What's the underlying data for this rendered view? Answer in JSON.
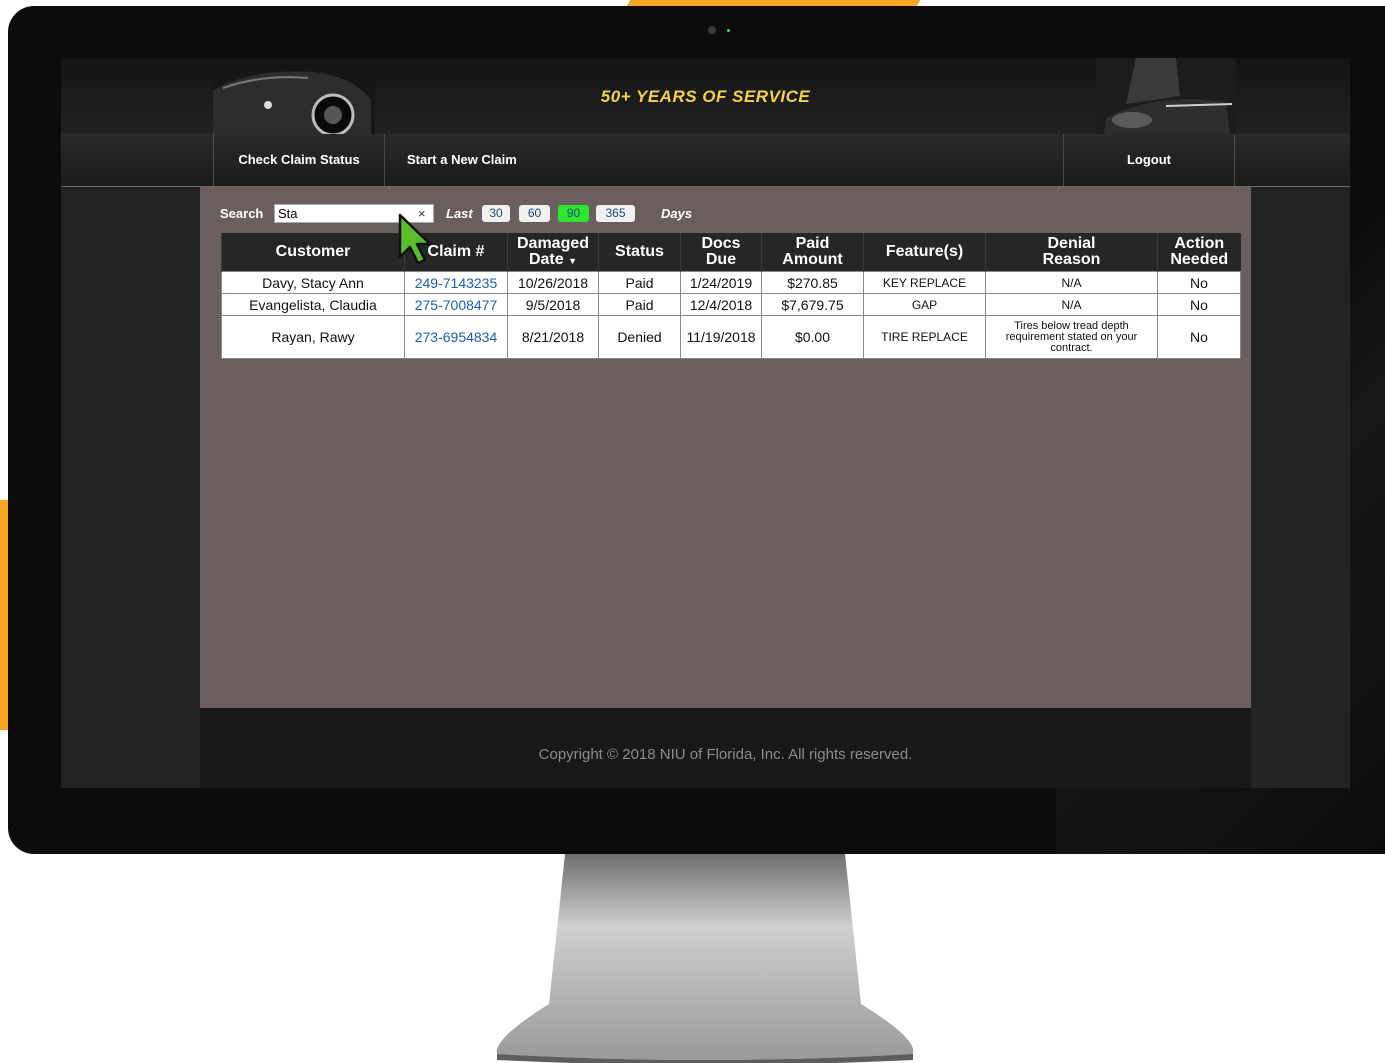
{
  "header": {
    "tagline": "50+ YEARS OF SERVICE"
  },
  "nav": {
    "check_status": "Check Claim Status",
    "new_claim": "Start a New Claim",
    "logout": "Logout"
  },
  "search": {
    "label": "Search",
    "value": "Sta",
    "clear": "×",
    "last_label": "Last",
    "days_label": "Days",
    "day_options": [
      "30",
      "60",
      "90",
      "365"
    ],
    "active_day": "90"
  },
  "table": {
    "headers": {
      "customer": "Customer",
      "claim": "Claim #",
      "damaged_line1": "Damaged",
      "damaged_line2": "Date",
      "status": "Status",
      "docs_line1": "Docs",
      "docs_line2": "Due",
      "paid_line1": "Paid",
      "paid_line2": "Amount",
      "features": "Feature(s)",
      "denial_line1": "Denial",
      "denial_line2": "Reason",
      "action_line1": "Action",
      "action_line2": "Needed"
    },
    "rows": [
      {
        "customer": "Davy, Stacy Ann",
        "claim": "249-7143235",
        "damaged": "10/26/2018",
        "status": "Paid",
        "docs_due": "1/24/2019",
        "paid": "$270.85",
        "feature": "KEY REPLACE",
        "denial": "N/A",
        "action": "No"
      },
      {
        "customer": "Evangelista, Claudia",
        "claim": "275-7008477",
        "damaged": "9/5/2018",
        "status": "Paid",
        "docs_due": "12/4/2018",
        "paid": "$7,679.75",
        "feature": "GAP",
        "denial": "N/A",
        "action": "No"
      },
      {
        "customer": "Rayan, Rawy",
        "claim": "273-6954834",
        "damaged": "8/21/2018",
        "status": "Denied",
        "docs_due": "11/19/2018",
        "paid": "$0.00",
        "feature": "TIRE REPLACE",
        "denial": "Tires below tread depth requirement stated on your contract.",
        "action": "No"
      }
    ]
  },
  "footer": {
    "copyright": "Copyright © 2018 NIU of Florida, Inc. All rights reserved."
  },
  "colors": {
    "accent_orange": "#f5a623",
    "tagline_gold": "#f2d24a",
    "active_day_green": "#2ee62e",
    "link_blue": "#1a5fb4",
    "cursor_green": "#5bbd2a"
  }
}
